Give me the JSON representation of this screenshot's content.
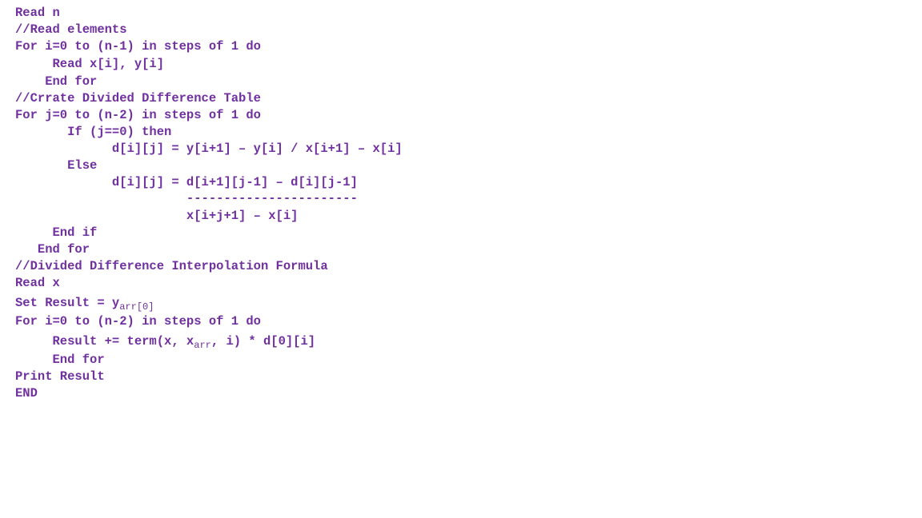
{
  "theme": {
    "text_color": "#7030A0",
    "background": "#ffffff"
  },
  "lines": [
    "Read n",
    "//Read elements",
    "For i=0 to (n-1) in steps of 1 do",
    "     Read x[i], y[i]",
    "    End for",
    "//Crrate Divided Difference Table",
    "For j=0 to (n-2) in steps of 1 do",
    "       If (j==0) then",
    "             d[i][j] = y[i+1] – y[i] / x[i+1] – x[i]",
    "       Else",
    "             d[i][j] = d[i+1][j-1] – d[i][j-1]",
    "                       -----------------------",
    "                       x[i+j+1] – x[i]",
    "     End if",
    "   End for",
    "//Divided Difference Interpolation Formula",
    "Read x",
    "Set Result = y",
    "For i=0 to (n-2) in steps of 1 do",
    "     Result += term(x, x",
    "     End for",
    "Print Result",
    "END"
  ],
  "line17_subscript": "arr[0]",
  "line19_subscript": "arr",
  "line19_tail": ", i) * d[0][i]"
}
